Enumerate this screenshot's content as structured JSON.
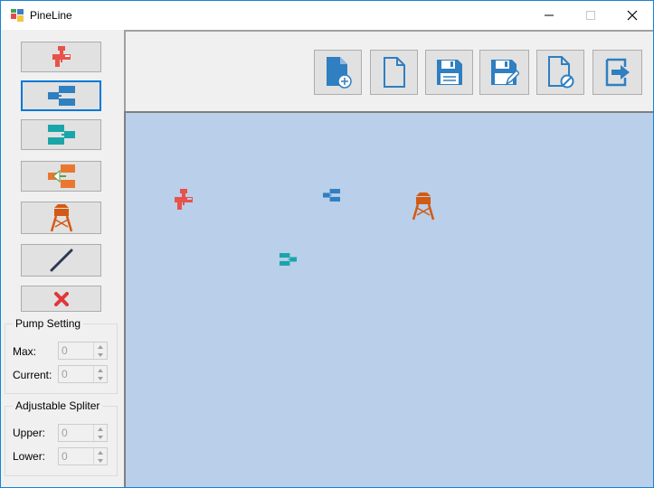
{
  "window": {
    "title": "PineLine",
    "controls": [
      "minimize-icon",
      "maximize-icon",
      "close-icon"
    ]
  },
  "sidebar": {
    "tools": [
      {
        "name": "pump-tool",
        "icon": "pump-icon",
        "selected": false
      },
      {
        "name": "splitter-tool",
        "icon": "splitter-icon",
        "selected": true
      },
      {
        "name": "merger-tool",
        "icon": "merger-icon",
        "selected": false
      },
      {
        "name": "adjustable-splitter-tool",
        "icon": "adjustable-splitter-icon",
        "selected": false
      },
      {
        "name": "sink-tool",
        "icon": "water-tower-icon",
        "selected": false
      },
      {
        "name": "pipeline-tool",
        "icon": "line-icon",
        "selected": false
      },
      {
        "name": "delete-tool",
        "icon": "delete-x-icon",
        "selected": false
      }
    ],
    "pump_setting": {
      "title": "Pump Setting",
      "max_label": "Max:",
      "max_value": "0",
      "current_label": "Current:",
      "current_value": "0"
    },
    "adjustable_splitter": {
      "title": "Adjustable Spliter",
      "upper_label": "Upper:",
      "upper_value": "0",
      "lower_label": "Lower:",
      "lower_value": "0"
    }
  },
  "toolbar": {
    "buttons": [
      "new-file-icon",
      "open-file-icon",
      "save-icon",
      "save-as-icon",
      "close-file-icon",
      "exit-icon"
    ]
  },
  "canvas": {
    "items": [
      "pump-icon",
      "splitter-icon",
      "water-tower-icon",
      "merger-icon"
    ]
  },
  "colors": {
    "pump": "#e8524a",
    "splitter": "#2f7fc1",
    "merger": "#1aa6a8",
    "adjustable_orange": "#e8782f",
    "sink": "#d35a12",
    "line": "#2b3a52",
    "delete": "#e0363a",
    "canvas_bg": "#b9cfea",
    "selection_border": "#0078d7"
  }
}
